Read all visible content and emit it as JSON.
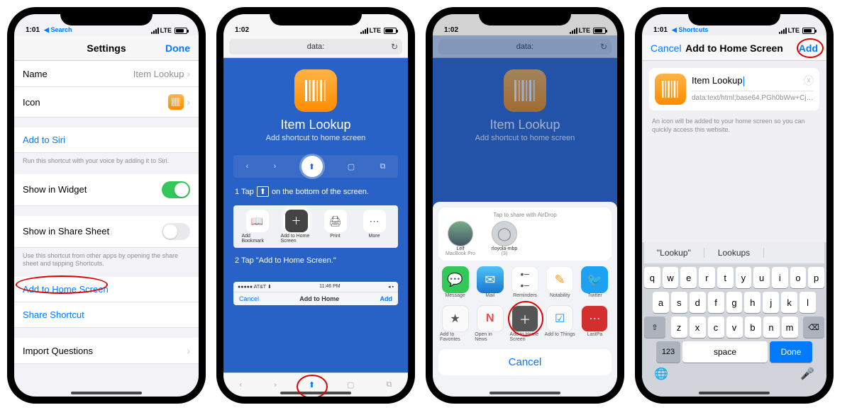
{
  "status": {
    "time": "1:01",
    "time2": "1:02",
    "back": "Search",
    "back3": "Shortcuts",
    "lte": "LTE"
  },
  "p1": {
    "title": "Settings",
    "done": "Done",
    "name_label": "Name",
    "name_value": "Item Lookup",
    "icon_label": "Icon",
    "siri": "Add to Siri",
    "siri_hint": "Run this shortcut with your voice by adding it to Siri.",
    "widget": "Show in Widget",
    "sharesheet": "Show in Share Sheet",
    "sharesheet_hint": "Use this shortcut from other apps by opening the share sheet and tapping Shortcuts.",
    "home": "Add to Home Screen",
    "share": "Share Shortcut",
    "import": "Import Questions"
  },
  "p2": {
    "url": "data:",
    "title": "Item Lookup",
    "sub": "Add shortcut to home screen",
    "step1_a": "1  Tap",
    "step1_b": "on the bottom of the screen.",
    "row": {
      "a": "Add Bookmark",
      "b": "Add to Home Screen",
      "c": "Print",
      "d": "More"
    },
    "step2": "2  Tap \"Add to Home Screen.\"",
    "mini": {
      "time": "11:46 PM",
      "cancel": "Cancel",
      "title": "Add to Home",
      "add": "Add"
    }
  },
  "p3": {
    "url": "data:",
    "airdrop": "Tap to share with AirDrop",
    "people": [
      {
        "n": "Leif",
        "s": "MacBook Pro"
      },
      {
        "n": "rloyola-mbp",
        "s": "(3)"
      }
    ],
    "apps": [
      {
        "n": "Message",
        "c": "#34c759"
      },
      {
        "n": "Mail",
        "c": "#2196f3"
      },
      {
        "n": "Reminders",
        "c": "#fff"
      },
      {
        "n": "Notability",
        "c": "#ff9800"
      },
      {
        "n": "Twitter",
        "c": "#1da1f2"
      }
    ],
    "actions": [
      {
        "n": "Add to Favorites",
        "g": "★"
      },
      {
        "n": "Open in News",
        "g": "N"
      },
      {
        "n": "Add to Home Screen",
        "g": "＋"
      },
      {
        "n": "Add to Things",
        "g": "☑"
      },
      {
        "n": "LastPa",
        "g": "•"
      }
    ],
    "cancel": "Cancel"
  },
  "p4": {
    "cancel": "Cancel",
    "title": "Add to Home Screen",
    "add": "Add",
    "name": "Item Lookup",
    "url": "data:text/html;base64,PGh0bWw+Cjx...",
    "desc": "An icon will be added to your home screen so you can quickly access this website.",
    "sugg": [
      "\"Lookup\"",
      "Lookups",
      ""
    ],
    "rows": [
      [
        "q",
        "w",
        "e",
        "r",
        "t",
        "y",
        "u",
        "i",
        "o",
        "p"
      ],
      [
        "a",
        "s",
        "d",
        "f",
        "g",
        "h",
        "j",
        "k",
        "l"
      ],
      [
        "z",
        "x",
        "c",
        "v",
        "b",
        "n",
        "m"
      ]
    ],
    "shift": "⇧",
    "bksp": "⌫",
    "num": "123",
    "space": "space",
    "done": "Done",
    "globe": "🌐",
    "mic": "🎤"
  }
}
